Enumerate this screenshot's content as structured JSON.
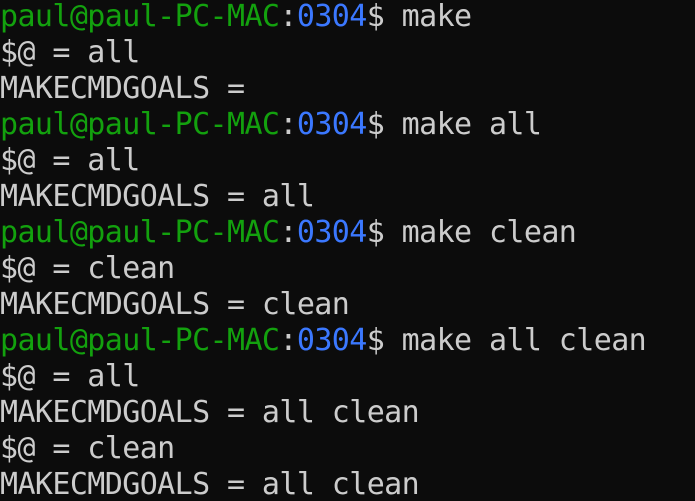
{
  "terminal": {
    "colors": {
      "background": "#0c0c0c",
      "text": "#cccccc",
      "user_host": "#13a10e",
      "path": "#3b78ff"
    },
    "lines": [
      {
        "type": "prompt",
        "user_host": "paul@paul-PC-MAC",
        "sep": ":",
        "path": "0304",
        "dollar": "$ ",
        "command": "make"
      },
      {
        "type": "output",
        "text": "$@ = all"
      },
      {
        "type": "output",
        "text": "MAKECMDGOALS ="
      },
      {
        "type": "prompt",
        "user_host": "paul@paul-PC-MAC",
        "sep": ":",
        "path": "0304",
        "dollar": "$ ",
        "command": "make all"
      },
      {
        "type": "output",
        "text": "$@ = all"
      },
      {
        "type": "output",
        "text": "MAKECMDGOALS = all"
      },
      {
        "type": "prompt",
        "user_host": "paul@paul-PC-MAC",
        "sep": ":",
        "path": "0304",
        "dollar": "$ ",
        "command": "make clean"
      },
      {
        "type": "output",
        "text": "$@ = clean"
      },
      {
        "type": "output",
        "text": "MAKECMDGOALS = clean"
      },
      {
        "type": "prompt",
        "user_host": "paul@paul-PC-MAC",
        "sep": ":",
        "path": "0304",
        "dollar": "$ ",
        "command": "make all clean"
      },
      {
        "type": "output",
        "text": "$@ = all"
      },
      {
        "type": "output",
        "text": "MAKECMDGOALS = all clean"
      },
      {
        "type": "output",
        "text": "$@ = clean"
      },
      {
        "type": "output",
        "text": "MAKECMDGOALS = all clean"
      }
    ]
  }
}
